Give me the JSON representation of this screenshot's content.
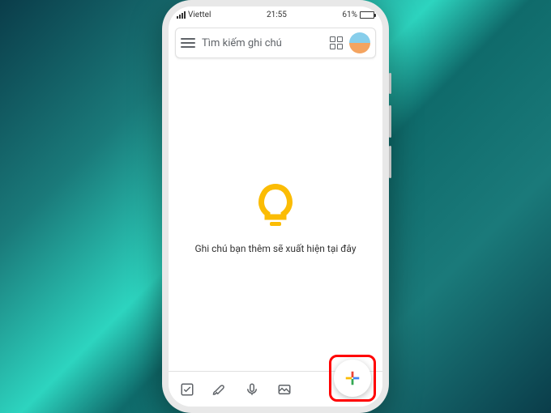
{
  "status": {
    "carrier": "Viettel",
    "time": "21:55",
    "battery_pct": "61%"
  },
  "search": {
    "placeholder": "Tìm kiếm ghi chú"
  },
  "empty_state": {
    "message": "Ghi chú bạn thêm sẽ xuất hiện tại đây"
  },
  "colors": {
    "accent_yellow": "#fbbc04",
    "google_blue": "#4285f4",
    "google_red": "#ea4335",
    "google_yellow": "#fbbc04",
    "google_green": "#34a853"
  }
}
